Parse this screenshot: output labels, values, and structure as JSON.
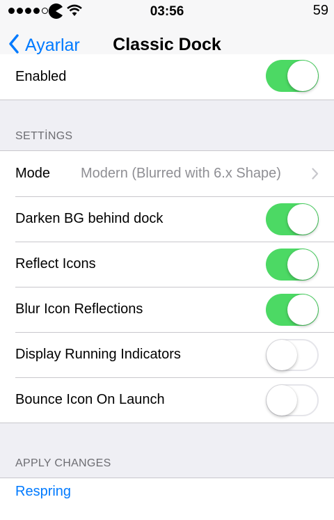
{
  "status_bar": {
    "time": "03:56",
    "battery": "59",
    "signal_dots": [
      true,
      true,
      true,
      true,
      false
    ],
    "carrier_icon": "pacman-icon",
    "wifi_icon": "wifi-icon"
  },
  "nav": {
    "back_label": "Ayarlar",
    "title": "Classic Dock",
    "accent_color": "#007aff"
  },
  "enabled_row": {
    "label": "Enabled",
    "on": true
  },
  "settings": {
    "header": "SETTİNGS",
    "mode": {
      "label": "Mode",
      "value": "Modern (Blurred with 6.x Shape)"
    },
    "toggles": [
      {
        "label": "Darken BG behind dock",
        "on": true
      },
      {
        "label": "Reflect Icons",
        "on": true
      },
      {
        "label": "Blur Icon Reflections",
        "on": true
      },
      {
        "label": "Display Running Indicators",
        "on": false
      },
      {
        "label": "Bounce Icon On Launch",
        "on": false
      }
    ]
  },
  "apply": {
    "header": "APPLY CHANGES",
    "respring_label": "Respring"
  },
  "colors": {
    "toggle_on": "#4cd964",
    "background": "#efeff4"
  }
}
